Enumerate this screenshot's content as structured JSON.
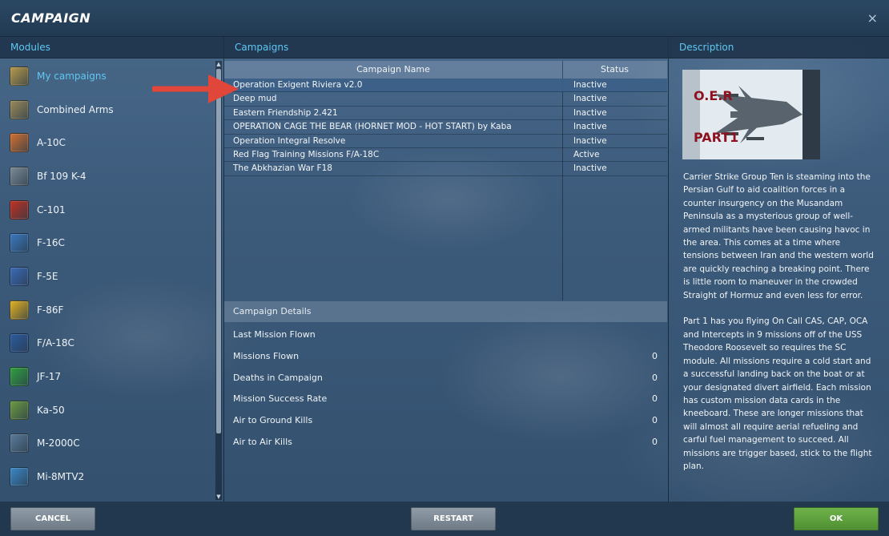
{
  "window": {
    "title": "CAMPAIGN",
    "close_glyph": "×"
  },
  "modules": {
    "header": "Modules",
    "items": [
      {
        "label": "My campaigns",
        "icon": "my-campaigns-icon",
        "color": "#b89a4a"
      },
      {
        "label": "Combined Arms",
        "icon": "combined-arms-icon",
        "color": "#9a8a5a"
      },
      {
        "label": "A-10C",
        "icon": "a10c-icon",
        "color": "#d07030"
      },
      {
        "label": "Bf 109 K-4",
        "icon": "bf109-icon",
        "color": "#7a8a96"
      },
      {
        "label": "C-101",
        "icon": "c101-icon",
        "color": "#c03020"
      },
      {
        "label": "F-16C",
        "icon": "f16c-icon",
        "color": "#3a78c0"
      },
      {
        "label": "F-5E",
        "icon": "f5e-icon",
        "color": "#3a6ab8"
      },
      {
        "label": "F-86F",
        "icon": "f86f-icon",
        "color": "#e0b020"
      },
      {
        "label": "F/A-18C",
        "icon": "fa18c-icon",
        "color": "#2a5aa0"
      },
      {
        "label": "JF-17",
        "icon": "jf17-icon",
        "color": "#30a040"
      },
      {
        "label": "Ka-50",
        "icon": "ka50-icon",
        "color": "#6a9a40"
      },
      {
        "label": "M-2000C",
        "icon": "m2000c-icon",
        "color": "#5a7a9a"
      },
      {
        "label": "Mi-8MTV2",
        "icon": "mi8-icon",
        "color": "#3a88c8"
      }
    ]
  },
  "campaigns": {
    "header": "Campaigns",
    "columns": {
      "name": "Campaign Name",
      "status": "Status"
    },
    "rows": [
      {
        "name": "Operation Exigent Riviera v2.0",
        "status": "Inactive"
      },
      {
        "name": "Deep mud",
        "status": "Inactive"
      },
      {
        "name": "Eastern Friendship 2.421",
        "status": "Inactive"
      },
      {
        "name": "OPERATION CAGE THE BEAR (HORNET MOD - HOT START) by Kaba",
        "status": "Inactive"
      },
      {
        "name": "Operation Integral Resolve",
        "status": "Inactive"
      },
      {
        "name": "Red Flag Training Missions F/A-18C",
        "status": "Active"
      },
      {
        "name": "The Abkhazian War F18",
        "status": "Inactive"
      }
    ],
    "details": {
      "header": "Campaign Details",
      "items": [
        {
          "label": "Last Mission Flown",
          "value": ""
        },
        {
          "label": "Missions Flown",
          "value": "0"
        },
        {
          "label": "Deaths in Campaign",
          "value": "0"
        },
        {
          "label": "Mission Success Rate",
          "value": "0"
        },
        {
          "label": "Air to Ground Kills",
          "value": "0"
        },
        {
          "label": "Air to Air Kills",
          "value": "0"
        }
      ]
    }
  },
  "description": {
    "header": "Description",
    "image_text_top": "O.E.R",
    "image_text_bottom": "PART1",
    "paragraph1": "Carrier Strike Group Ten is steaming into the Persian Gulf to aid coalition forces in a counter insurgency on the Musandam Peninsula as a mysterious group of well-armed militants have been causing havoc in the area. This comes at a time where tensions between Iran and the western world are quickly reaching a breaking point. There is little room to maneuver in the crowded Straight of Hormuz and even less for error.",
    "paragraph2": "Part 1 has you flying On Call CAS, CAP, OCA and Intercepts in 9 missions off of the USS Theodore Roosevelt so requires the SC module. All missions require a cold start and a successful landing back on the boat or at your designated divert airfield. Each mission has custom mission data cards in the kneeboard. These are longer missions that will almost all require aerial refueling and carful fuel management to succeed. All missions are trigger based, stick to the flight plan."
  },
  "buttons": {
    "cancel": "CANCEL",
    "restart": "RESTART",
    "ok": "OK"
  },
  "colors": {
    "accent": "#5ec8f2",
    "ok_green": "#5fa23d",
    "arrow_red": "#e0463a"
  }
}
